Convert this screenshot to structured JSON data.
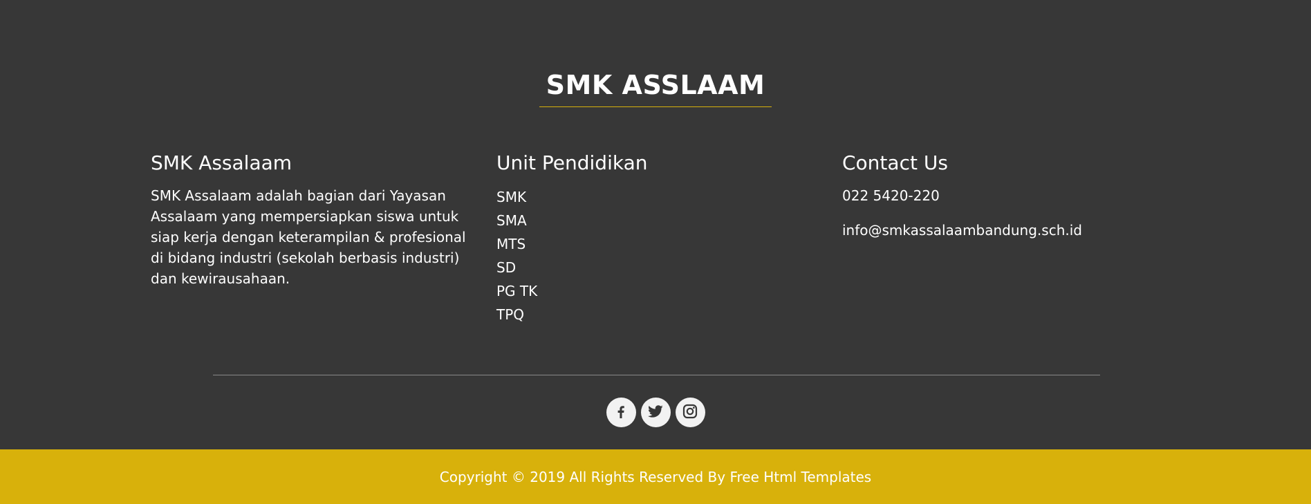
{
  "brand": {
    "title": "SMK ASSLAAM"
  },
  "about": {
    "heading": "SMK Assalaam",
    "text": "SMK Assalaam adalah bagian dari Yayasan Assalaam yang mempersiapkan siswa untuk siap kerja dengan keterampilan & profesional di bidang industri (sekolah berbasis industri) dan kewirausahaan."
  },
  "units": {
    "heading": "Unit Pendidikan",
    "items": [
      "SMK",
      "SMA",
      "MTS",
      "SD",
      "PG TK",
      "TPQ"
    ]
  },
  "contact": {
    "heading": "Contact Us",
    "phone": "022 5420-220",
    "email": "info@smkassalaambandung.sch.id"
  },
  "social": {
    "icons": [
      "facebook-icon",
      "twitter-icon",
      "instagram-icon"
    ]
  },
  "copyright": {
    "text": "Copyright © 2019 All Rights Reserved By Free Html Templates"
  },
  "colors": {
    "background": "#373737",
    "accent": "#d8b10b",
    "text": "#ffffff",
    "icon_bg": "#f2f2f2",
    "icon_fg": "#373737"
  }
}
